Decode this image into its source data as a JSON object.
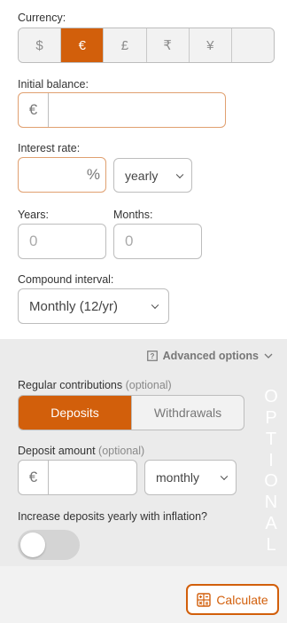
{
  "currency": {
    "label": "Currency:",
    "options": [
      "$",
      "€",
      "£",
      "₹",
      "¥",
      ""
    ],
    "selected_index": 1
  },
  "initial_balance": {
    "label": "Initial balance:",
    "prefix": "€",
    "value": ""
  },
  "interest_rate": {
    "label": "Interest rate:",
    "value": "",
    "suffix": "%",
    "period": "yearly"
  },
  "years": {
    "label": "Years:",
    "placeholder": "0"
  },
  "months": {
    "label": "Months:",
    "placeholder": "0"
  },
  "compound": {
    "label": "Compound interval:",
    "value": "Monthly (12/yr)"
  },
  "advanced": {
    "toggle_label": "Advanced options",
    "contributions_label": "Regular contributions",
    "optional_text": "(optional)",
    "tabs": [
      "Deposits",
      "Withdrawals"
    ],
    "active_tab": 0,
    "side_text": "OPTIONAL",
    "deposit_label": "Deposit amount",
    "deposit_optional": "(optional)",
    "deposit_prefix": "€",
    "deposit_frequency": "monthly",
    "inflation_label": "Increase deposits yearly with inflation?",
    "inflation_enabled": false
  },
  "calculate_label": "Calculate",
  "colors": {
    "accent": "#d25f0b",
    "panel": "#ebebeb"
  }
}
